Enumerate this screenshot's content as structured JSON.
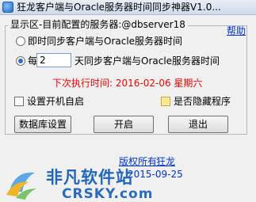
{
  "window": {
    "title": "狂龙客户端与Oracle服务器时间同步神器V1.0..."
  },
  "group": {
    "legend": "显示区-目前配置的服务器:@dbserver18"
  },
  "help": {
    "label": "帮助"
  },
  "options": {
    "realtime_label": "即时同步客户端与Oracle服务器时间",
    "realtime_checked": false,
    "every_prefix": "每",
    "days_value": "2",
    "every_suffix": "天同步客户端与Oracle服务器时间",
    "every_checked": true
  },
  "next_run": {
    "text": "下次执行时间: 2016-02-06   星期六"
  },
  "checkboxes": {
    "autostart_label": "设置开机自启",
    "autostart_checked": false,
    "hide_label": "是否隐藏程序",
    "hide_checked": false
  },
  "buttons": {
    "db_settings": "数据库设置",
    "start": "开启",
    "exit": "退出"
  },
  "footer": {
    "copyright_label": "版权所有",
    "author": "狂龙",
    "date": "2015-09-25"
  },
  "watermark": {
    "text": "非凡软件站",
    "domain": "CRSKY.com"
  },
  "colors": {
    "link": "#0033cc",
    "next_run": "#ff0000",
    "watermark": "#2266bb"
  }
}
